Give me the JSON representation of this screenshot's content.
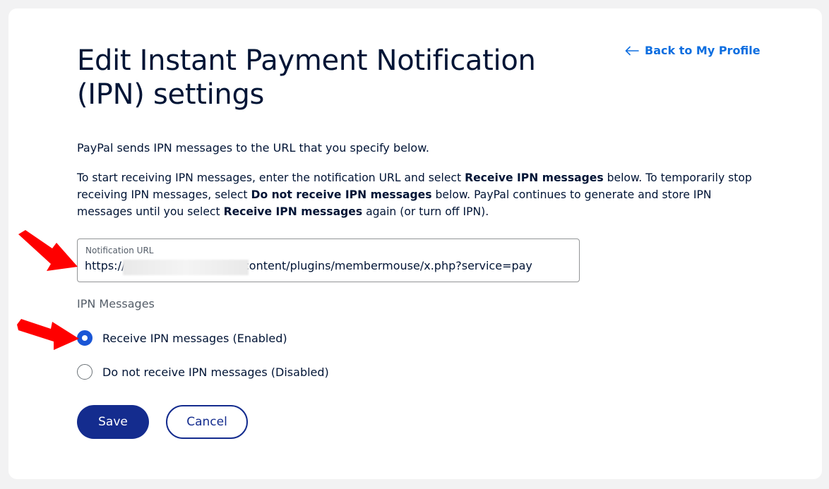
{
  "header": {
    "title": "Edit Instant Payment Notification (IPN) settings",
    "back_link": "Back to My Profile"
  },
  "intro": {
    "p1": "PayPal sends IPN messages to the URL that you specify below.",
    "p2_parts": [
      "To start receiving IPN messages, enter the notification URL and select ",
      "Receive IPN messages",
      " below. To temporarily stop receiving IPN messages, select ",
      "Do not receive IPN messages",
      " below. PayPal continues to generate and store IPN messages until you select ",
      "Receive IPN messages",
      " again (or turn off IPN)."
    ]
  },
  "url_field": {
    "label": "Notification URL",
    "value": "https://                          /wp-content/plugins/membermouse/x.php?service=pay"
  },
  "ipn": {
    "label": "IPN Messages",
    "options": [
      {
        "label": "Receive IPN messages (Enabled)",
        "selected": true
      },
      {
        "label": "Do not receive IPN messages (Disabled)",
        "selected": false
      }
    ]
  },
  "actions": {
    "save": "Save",
    "cancel": "Cancel"
  },
  "colors": {
    "link": "#0d6ee0",
    "primary": "#142c8e",
    "radio_selected": "#1a56d6",
    "annotation_arrow": "#ff0000"
  }
}
